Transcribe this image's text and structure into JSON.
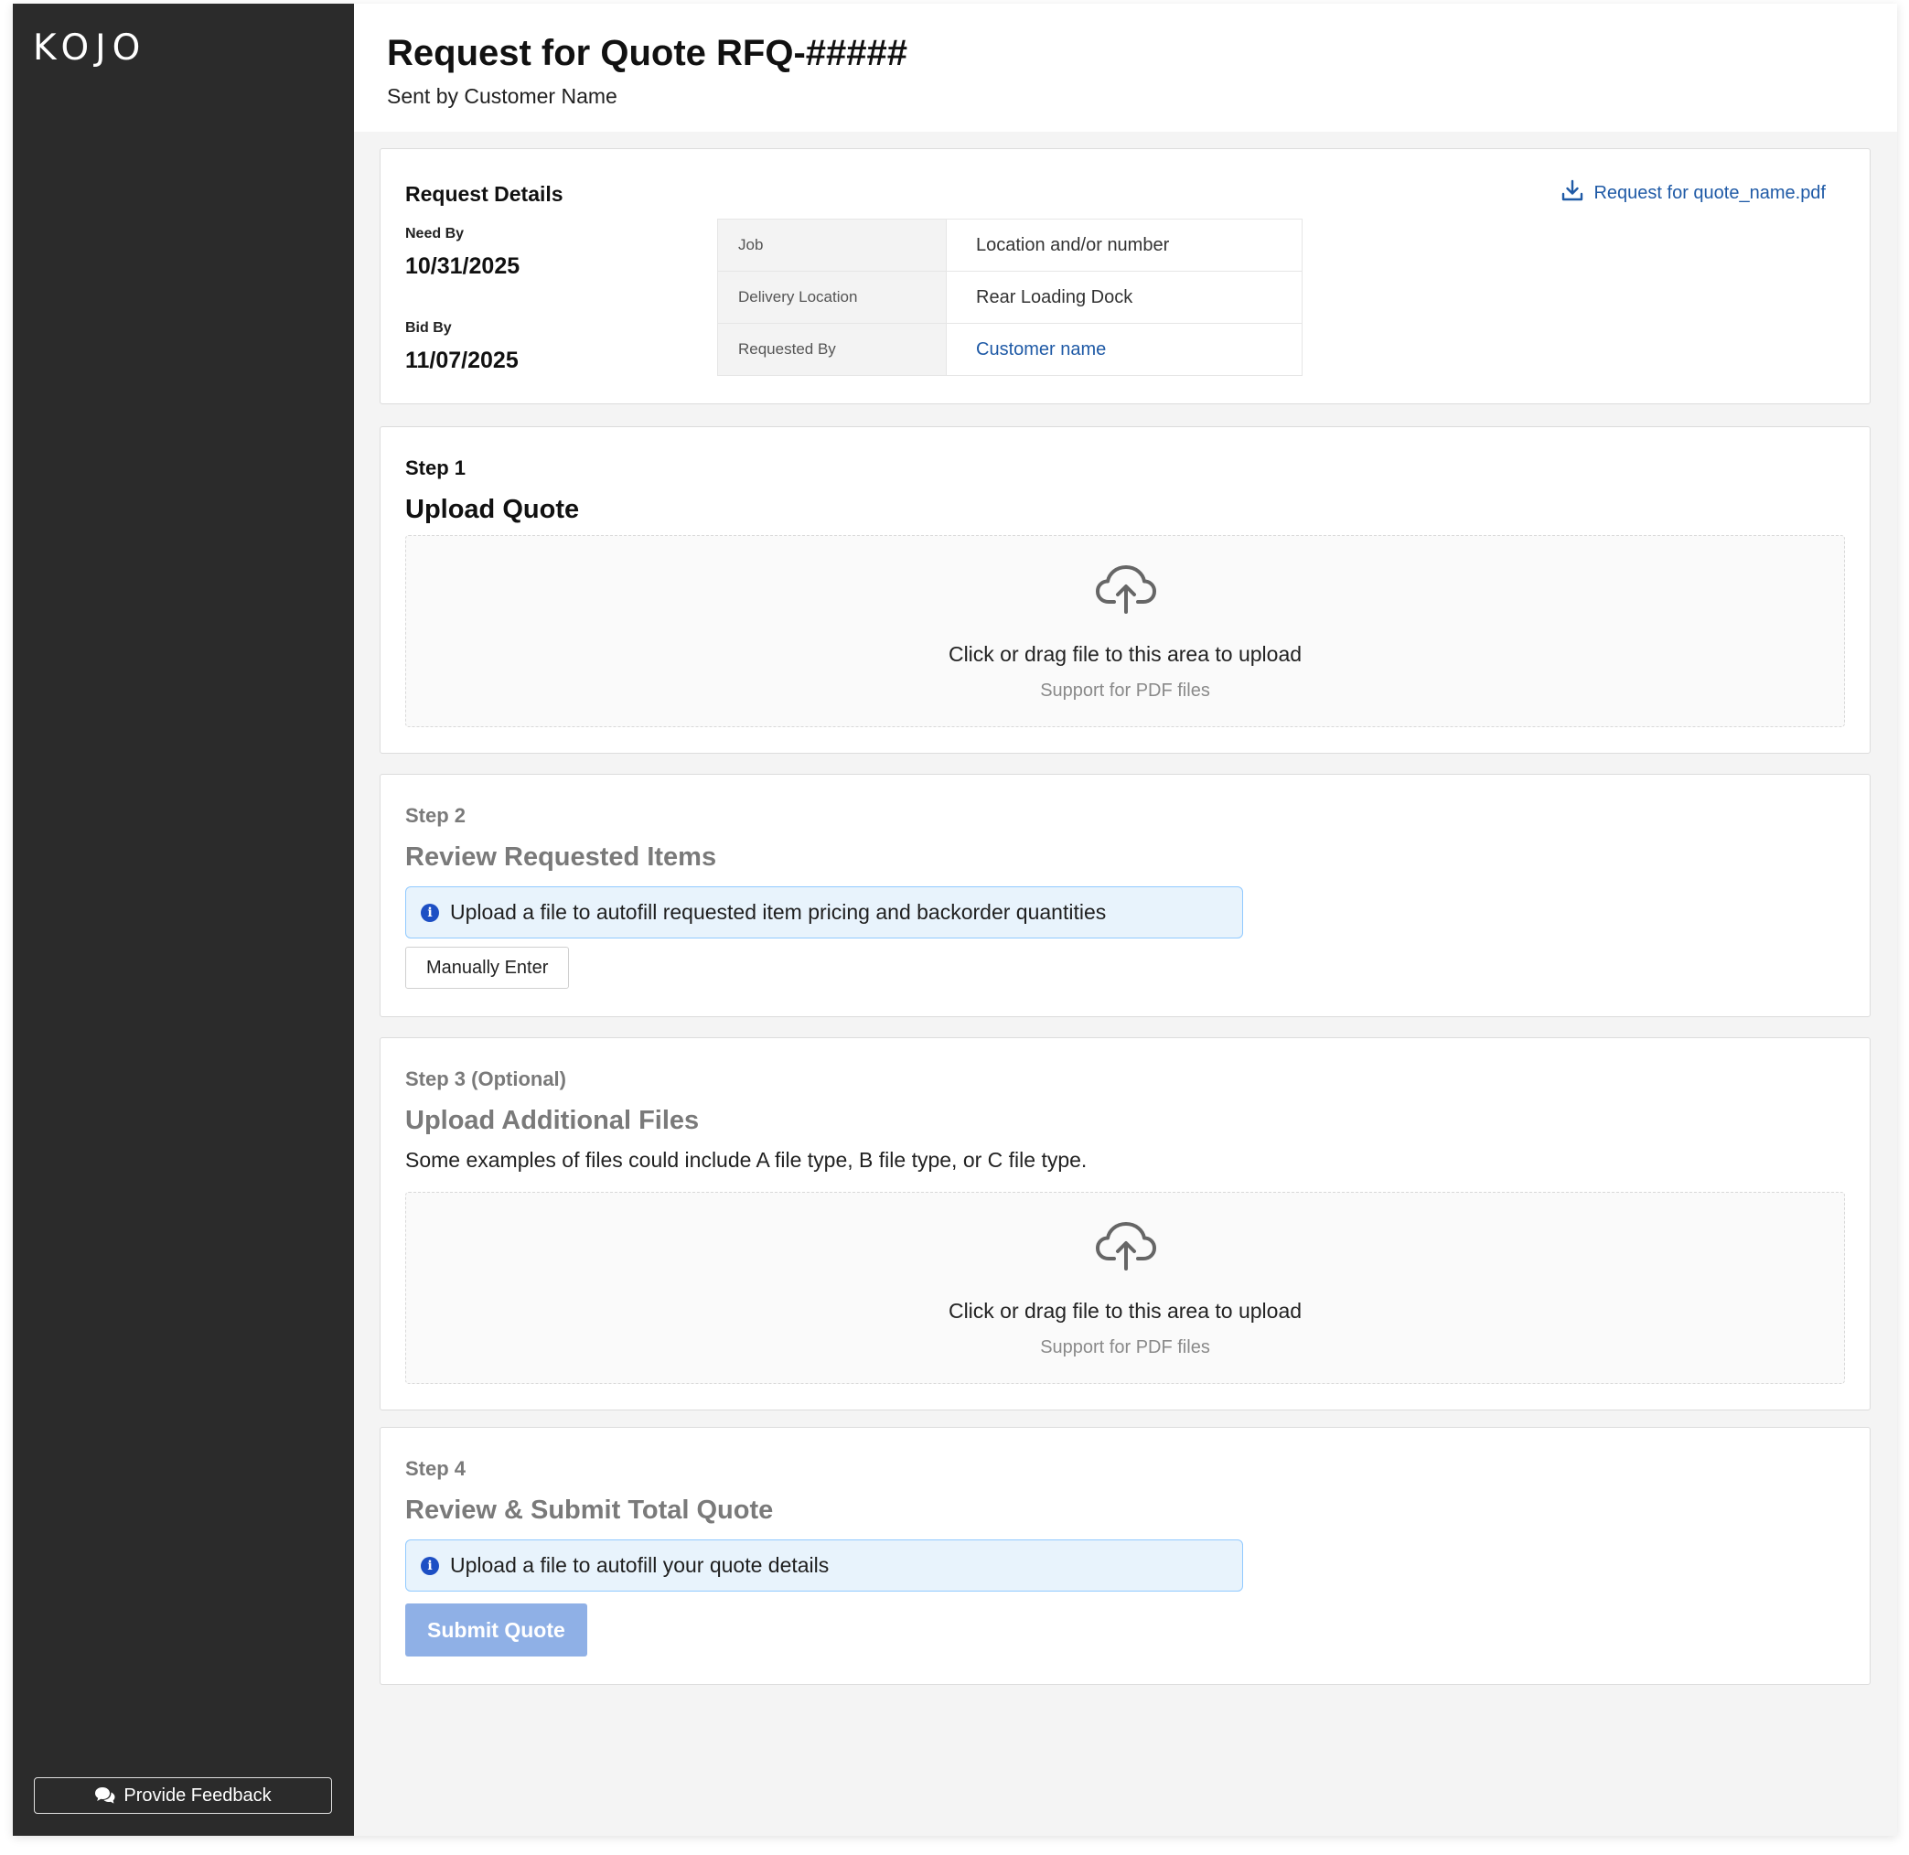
{
  "app": {
    "logo": "KOJO"
  },
  "sidebar": {
    "feedback_label": "Provide Feedback"
  },
  "header": {
    "title": "Request for Quote RFQ-#####",
    "subtitle": "Sent by Customer Name"
  },
  "request_details": {
    "heading": "Request Details",
    "need_by_label": "Need By",
    "need_by_value": "10/31/2025",
    "bid_by_label": "Bid By",
    "bid_by_value": "11/07/2025",
    "attachment": "Request for quote_name.pdf",
    "rows": [
      {
        "key": "Job",
        "value": "Location and/or number"
      },
      {
        "key": "Delivery Location",
        "value": "Rear Loading Dock"
      },
      {
        "key": "Requested By",
        "value": "Customer name"
      }
    ]
  },
  "step1": {
    "label": "Step 1",
    "title": "Upload Quote",
    "dropzone_text": "Click or drag file to this area to upload",
    "dropzone_hint": "Support for PDF files"
  },
  "step2": {
    "label": "Step 2",
    "title": "Review Requested Items",
    "info": "Upload a file to autofill requested item pricing and backorder quantities",
    "manual_button": "Manually Enter"
  },
  "step3": {
    "label": "Step 3 (Optional)",
    "title": "Upload Additional Files",
    "description": "Some examples of files could include A file type, B file type, or C file type.",
    "dropzone_text": "Click or drag file to this area to upload",
    "dropzone_hint": "Support for PDF files"
  },
  "step4": {
    "label": "Step 4",
    "title": "Review & Submit Total Quote",
    "info": "Upload a file to autofill your quote details",
    "submit_button": "Submit Quote"
  },
  "colors": {
    "sidebar_bg": "#2b2b2b",
    "link": "#1f5aa6",
    "info_bg": "#e8f3fc",
    "info_border": "#91caff",
    "submit_disabled": "#8fb0e6"
  }
}
